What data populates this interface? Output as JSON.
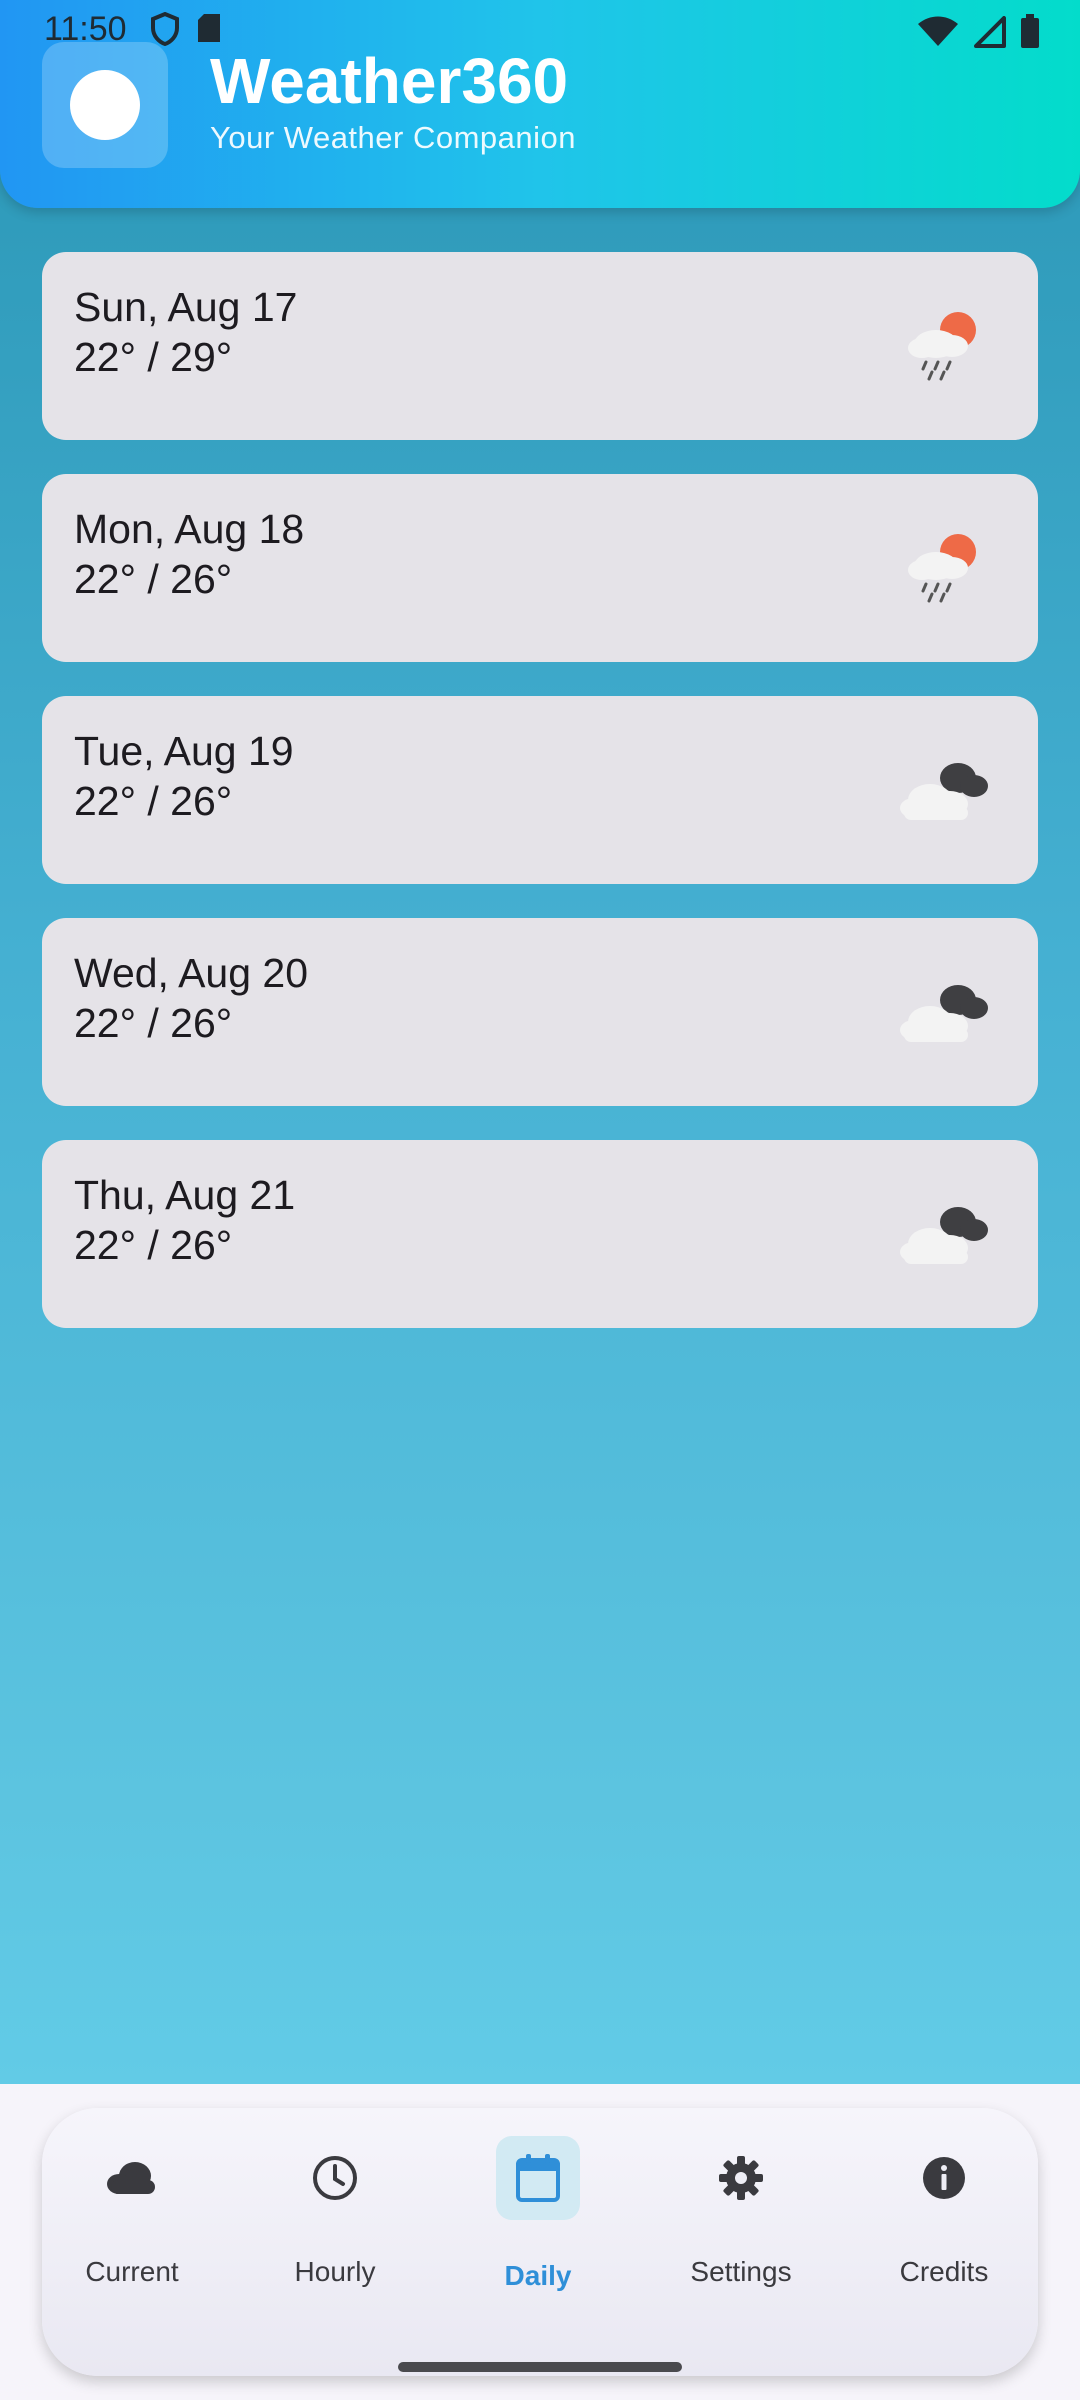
{
  "status_bar": {
    "time": "11:50"
  },
  "header": {
    "title": "Weather360",
    "subtitle": "Your Weather Companion"
  },
  "forecast": [
    {
      "day": "Sun, Aug 17",
      "temp": "22° / 29°",
      "icon": "rain-sun-icon"
    },
    {
      "day": "Mon, Aug 18",
      "temp": "22° / 26°",
      "icon": "rain-sun-icon"
    },
    {
      "day": "Tue, Aug 19",
      "temp": "22° / 26°",
      "icon": "clouds-icon"
    },
    {
      "day": "Wed, Aug 20",
      "temp": "22° / 26°",
      "icon": "clouds-icon"
    },
    {
      "day": "Thu, Aug 21",
      "temp": "22° / 26°",
      "icon": "clouds-icon"
    }
  ],
  "nav": {
    "items": [
      {
        "label": "Current",
        "icon": "cloud-icon"
      },
      {
        "label": "Hourly",
        "icon": "clock-icon"
      },
      {
        "label": "Daily",
        "icon": "calendar-icon",
        "active": true
      },
      {
        "label": "Settings",
        "icon": "gear-icon"
      },
      {
        "label": "Credits",
        "icon": "info-icon"
      }
    ]
  },
  "colors": {
    "accent": "#2f8fd8",
    "card": "#e5e3e8",
    "header_start": "#2196f3",
    "header_end": "#03dccb"
  }
}
